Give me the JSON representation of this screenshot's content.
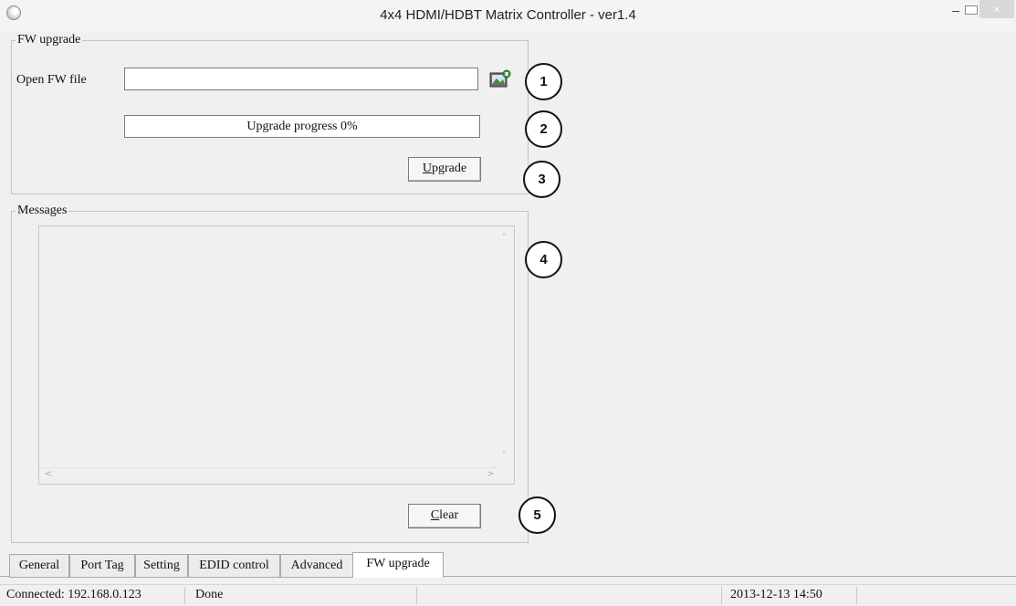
{
  "window": {
    "title": "4x4 HDMI/HDBT Matrix Controller - ver1.4",
    "min_glyph": "–",
    "close_glyph": "×"
  },
  "fw_group": {
    "title": "FW upgrade",
    "open_label": "Open FW file",
    "file_value": "",
    "progress_text": "Upgrade progress 0%",
    "progress_value": 0,
    "upgrade_hotkey": "U",
    "upgrade_rest": "pgrade"
  },
  "messages_group": {
    "title": "Messages",
    "text": "",
    "clear_hotkey": "C",
    "clear_rest": "lear"
  },
  "callouts": [
    "1",
    "2",
    "3",
    "4",
    "5"
  ],
  "tabs": [
    {
      "label": "General"
    },
    {
      "label": "Port Tag"
    },
    {
      "label": "Setting"
    },
    {
      "label": "EDID control"
    },
    {
      "label": "Advanced"
    },
    {
      "label": "FW upgrade",
      "active": true
    }
  ],
  "status": {
    "connection": "Connected: 192.168.0.123",
    "state": "Done",
    "datetime": "2013-12-13 14:50"
  },
  "icons": {
    "app": "app-icon",
    "open_file": "open-folder-icon"
  }
}
